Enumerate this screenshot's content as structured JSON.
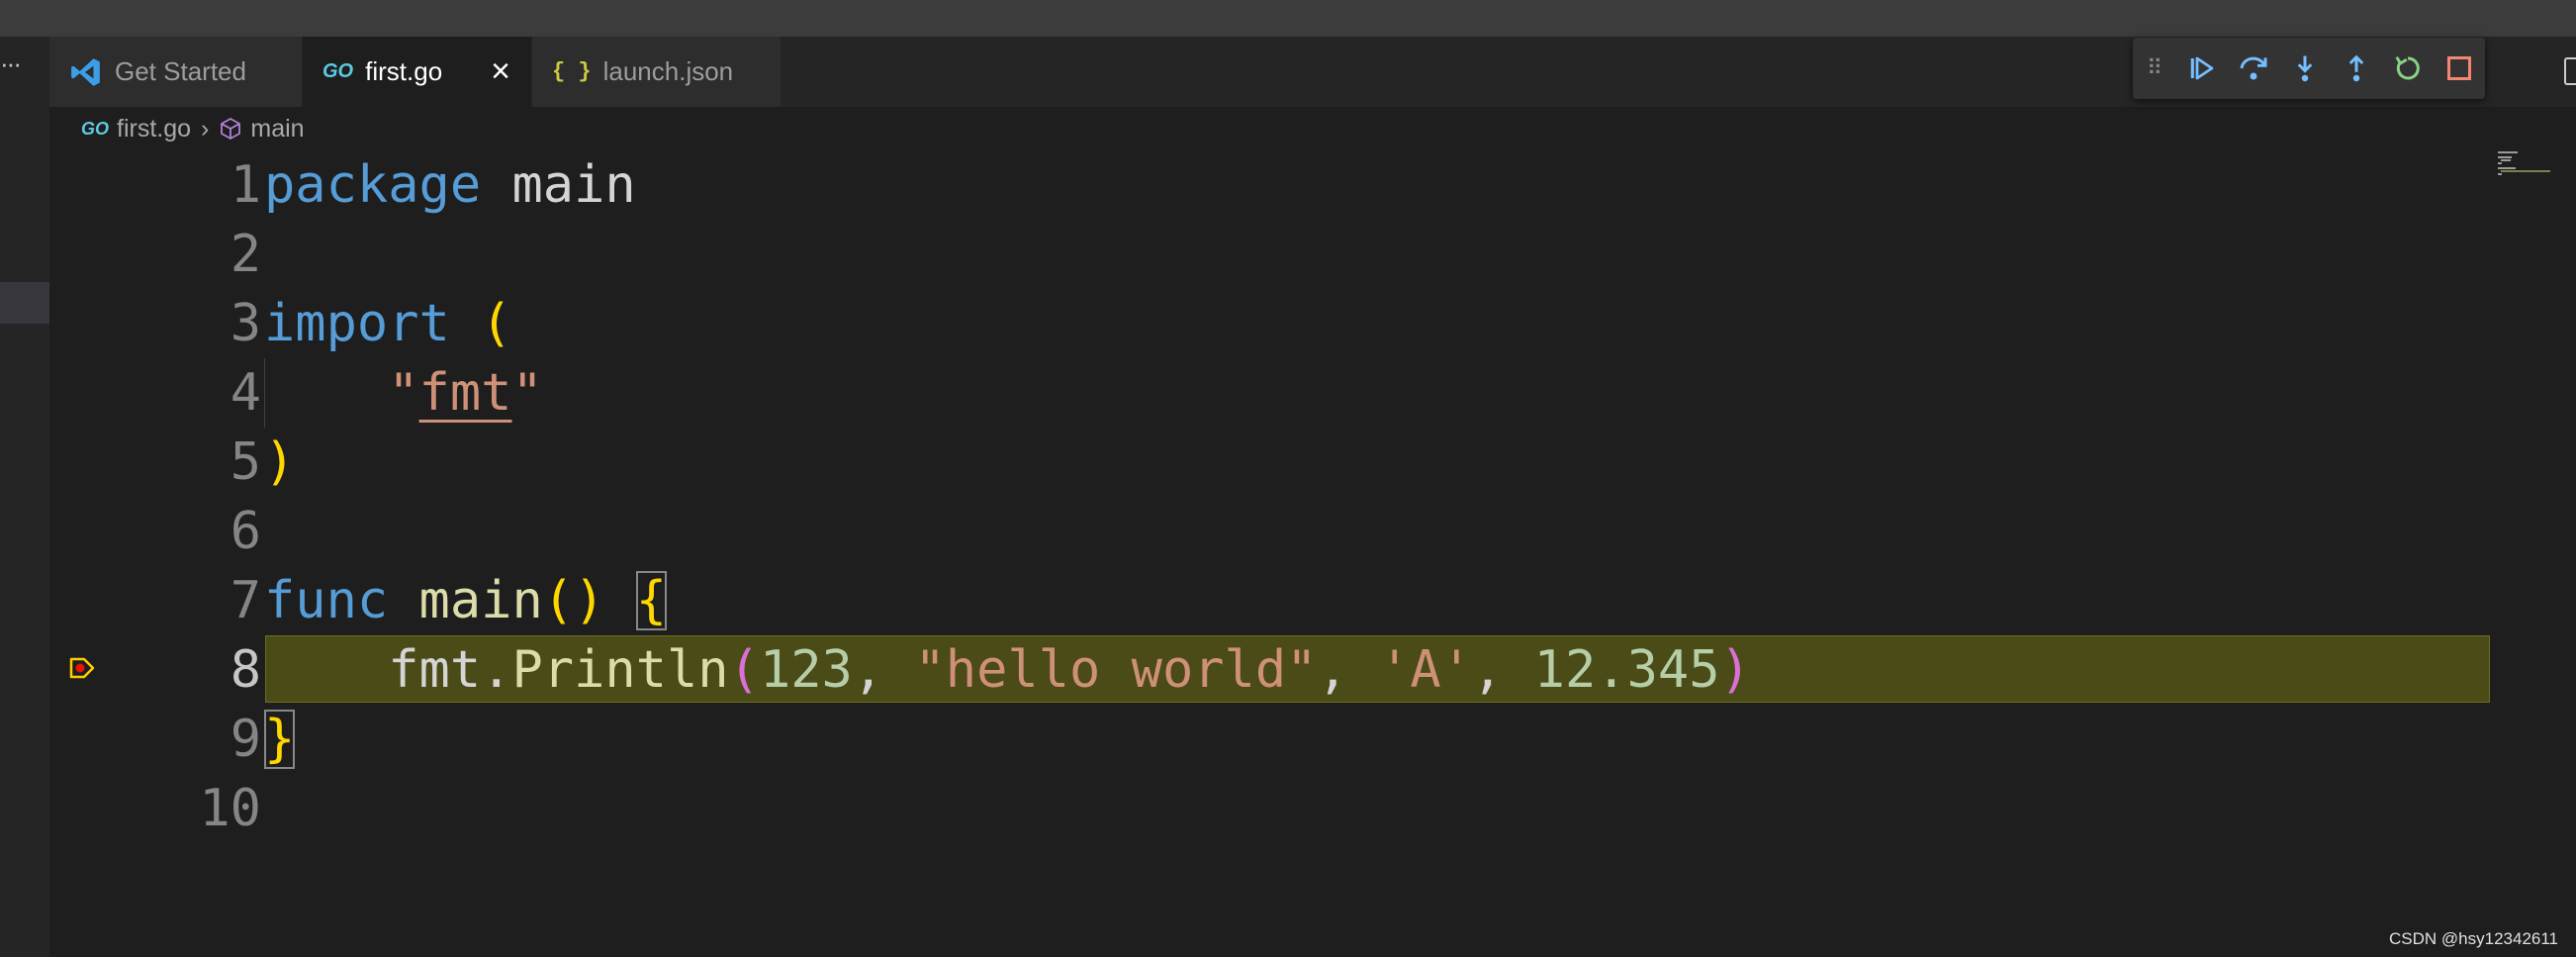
{
  "tabs": [
    {
      "label": "Get Started",
      "icon": "vscode-icon"
    },
    {
      "label": "first.go",
      "icon": "go-file-icon",
      "active": true,
      "logo_text": "GO"
    },
    {
      "label": "launch.json",
      "icon": "json-file-icon",
      "logo_text": "{ }"
    }
  ],
  "debug_toolbar": [
    "drag-grip-icon",
    "continue-icon",
    "step-over-icon",
    "step-into-icon",
    "step-out-icon",
    "restart-icon",
    "stop-icon"
  ],
  "breadcrumb": {
    "file": "first.go",
    "symbol": "main",
    "file_logo_text": "GO"
  },
  "editor": {
    "current_line": 8,
    "line_numbers": [
      "1",
      "2",
      "3",
      "4",
      "5",
      "6",
      "7",
      "8",
      "9",
      "10"
    ],
    "code": {
      "l1_kw": "package",
      "l1_name": "main",
      "l3_kw": "import",
      "l3_paren": "(",
      "l4_q1": "\"",
      "l4_pkg": "fmt",
      "l4_q2": "\"",
      "l5_paren": ")",
      "l7_kw": "func",
      "l7_fn": "main",
      "l7_parens": "()",
      "l7_brace": "{",
      "l8_obj": "fmt",
      "l8_dot": ".",
      "l8_fn": "Println",
      "l8_open": "(",
      "l8_num1": "123",
      "l8_comma1": ", ",
      "l8_str1": "\"hello world\"",
      "l8_comma2": ", ",
      "l8_str2": "'A'",
      "l8_comma3": ", ",
      "l8_num2": "12.345",
      "l8_close": ")",
      "l9_brace": "}"
    }
  },
  "colors": {
    "keyword": "#569cd6",
    "function": "#dcdcaa",
    "string": "#ce9178",
    "number": "#b5cea8",
    "bracket": "#ffd700",
    "bracket2": "#da70d6",
    "highlight": "#4b4b18"
  },
  "watermark": "CSDN @hsy12342611"
}
